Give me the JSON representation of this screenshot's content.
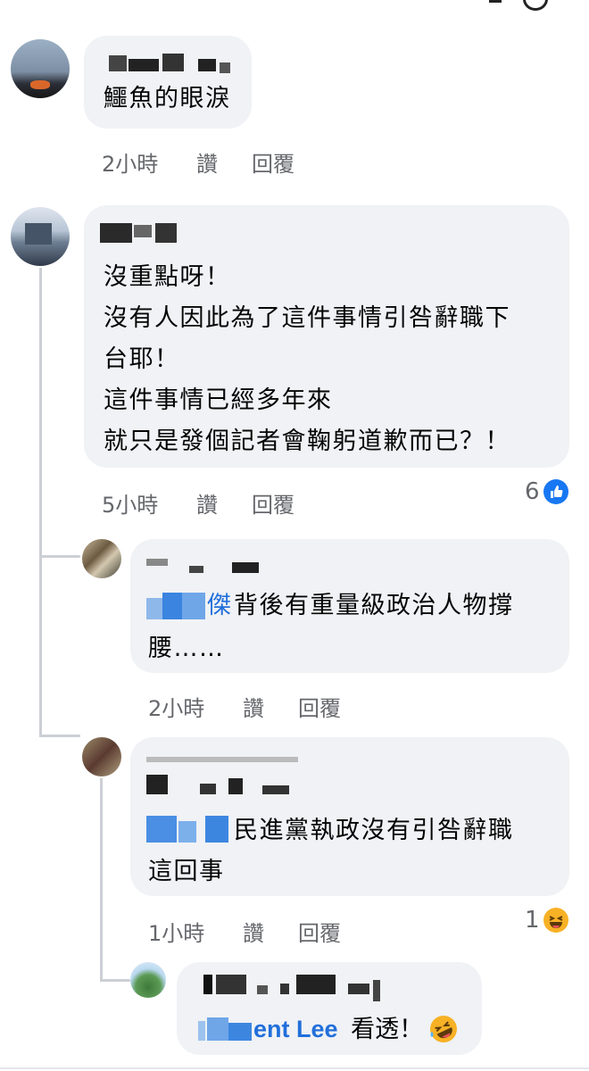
{
  "comments": [
    {
      "text_lines": [
        "鱷魚的眼淚"
      ],
      "time": "2小時",
      "like_label": "讚",
      "reply_label": "回覆"
    },
    {
      "text_lines": [
        "沒重點呀！",
        "沒有人因此為了這件事情引咎辭職下",
        "台耶！",
        "這件事情已經多年來",
        "就只是發個記者會鞠躬道歉而已？！"
      ],
      "time": "5小時",
      "like_label": "讚",
      "reply_label": "回覆",
      "reaction_count": "6",
      "reaction_icon": "like-icon"
    }
  ],
  "replies": [
    {
      "mention_suffix": "傑",
      "text_lines": [
        "背後有重量級政治人物撐",
        "腰……"
      ],
      "time": "2小時",
      "like_label": "讚",
      "reply_label": "回覆"
    },
    {
      "text_lines": [
        "民進黨執政沒有引咎辭職",
        "這回事"
      ],
      "time": "1小時",
      "like_label": "讚",
      "reply_label": "回覆",
      "reaction_count": "1",
      "reaction_icon": "haha-icon"
    },
    {
      "mention_visible": "ent Lee",
      "text": "看透！",
      "emoji_icon": "rofl-icon"
    }
  ],
  "colors": {
    "bubble": "#f0f2f5",
    "meta_text": "#65676b",
    "like_blue": "#1877f2",
    "mention_blue": "#216fdb",
    "haha_yellow": "#f7b125"
  }
}
